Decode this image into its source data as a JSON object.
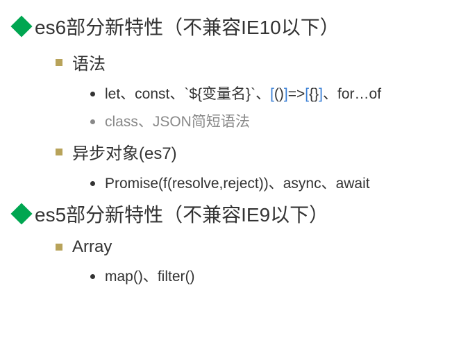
{
  "sections": [
    {
      "title": "es6部分新特性（不兼容IE10以下）",
      "children": [
        {
          "title": "语法",
          "items": [
            {
              "segments": [
                {
                  "text": "let、const、`${变量名}`、",
                  "color": "normal"
                },
                {
                  "text": "[",
                  "color": "blue"
                },
                {
                  "text": "()",
                  "color": "normal"
                },
                {
                  "text": "]",
                  "color": "blue"
                },
                {
                  "text": "=>",
                  "color": "normal"
                },
                {
                  "text": "[",
                  "color": "blue"
                },
                {
                  "text": "{}",
                  "color": "normal"
                },
                {
                  "text": "]",
                  "color": "blue"
                },
                {
                  "text": "、for…of",
                  "color": "normal"
                }
              ],
              "dim": false
            },
            {
              "segments": [
                {
                  "text": "class、JSON简短语法",
                  "color": "normal"
                }
              ],
              "dim": true
            }
          ]
        },
        {
          "title": "异步对象(es7)",
          "items": [
            {
              "segments": [
                {
                  "text": "Promise(f(resolve,reject))、async、await",
                  "color": "normal"
                }
              ],
              "dim": false
            }
          ]
        }
      ]
    },
    {
      "title": "es5部分新特性（不兼容IE9以下）",
      "children": [
        {
          "title": "Array",
          "items": [
            {
              "segments": [
                {
                  "text": "map()、filter()",
                  "color": "normal"
                }
              ],
              "dim": false
            }
          ]
        }
      ]
    }
  ]
}
